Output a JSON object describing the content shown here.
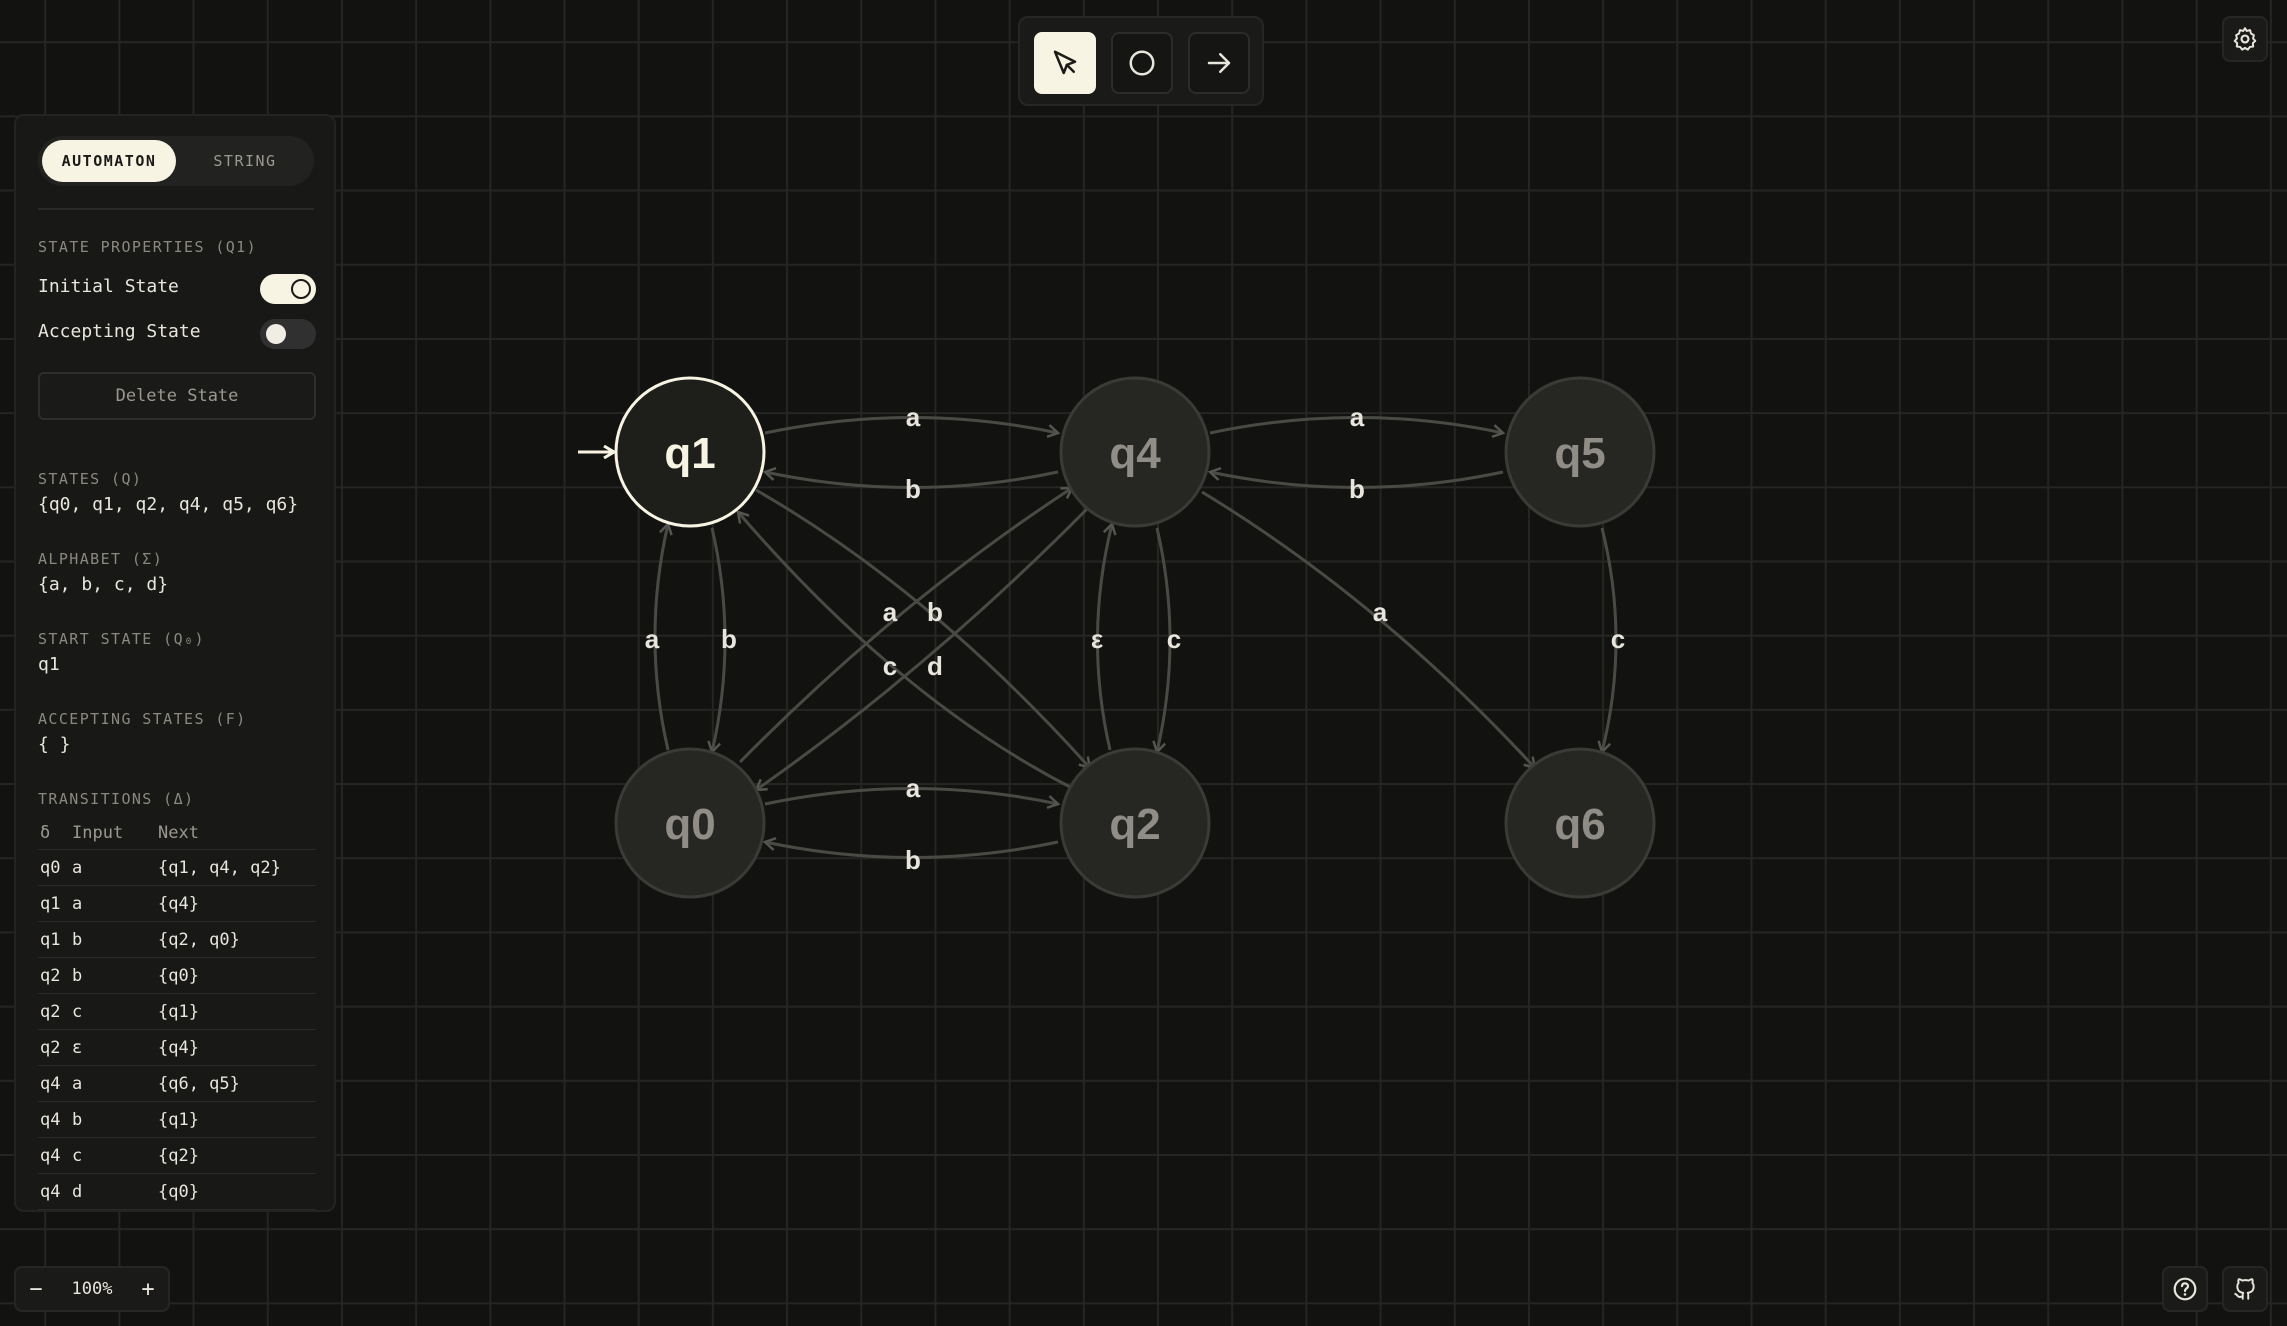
{
  "toolbar": {
    "tools": [
      {
        "name": "select",
        "icon": "cursor-icon",
        "active": true
      },
      {
        "name": "add-state",
        "icon": "circle-icon",
        "active": false
      },
      {
        "name": "add-transition",
        "icon": "arrow-right-icon",
        "active": false
      }
    ]
  },
  "sidebar": {
    "tabs": [
      {
        "label": "AUTOMATON",
        "active": true
      },
      {
        "label": "STRING",
        "active": false
      }
    ],
    "state_properties": {
      "title": "STATE PROPERTIES (Q1)",
      "initial_label": "Initial State",
      "initial_on": true,
      "accepting_label": "Accepting State",
      "accepting_on": false,
      "delete_label": "Delete State"
    },
    "states_label": "STATES (Q)",
    "states_value": "{q0, q1, q2, q4, q5, q6}",
    "alphabet_label": "ALPHABET (Σ)",
    "alphabet_value": "{a, b, c, d}",
    "start_label": "START STATE (Q₀)",
    "start_value": "q1",
    "accepting_states_label": "ACCEPTING STATES (F)",
    "accepting_states_value": "{ }",
    "transitions_label": "TRANSITIONS (Δ)",
    "transitions_header": {
      "from": "δ",
      "input": "Input",
      "next": "Next"
    },
    "transitions": [
      {
        "from": "q0",
        "input": "a",
        "next": "{q1, q4, q2}"
      },
      {
        "from": "q1",
        "input": "a",
        "next": "{q4}"
      },
      {
        "from": "q1",
        "input": "b",
        "next": "{q2, q0}"
      },
      {
        "from": "q2",
        "input": "b",
        "next": "{q0}"
      },
      {
        "from": "q2",
        "input": "c",
        "next": "{q1}"
      },
      {
        "from": "q2",
        "input": "ε",
        "next": "{q4}"
      },
      {
        "from": "q4",
        "input": "a",
        "next": "{q6, q5}"
      },
      {
        "from": "q4",
        "input": "b",
        "next": "{q1}"
      },
      {
        "from": "q4",
        "input": "c",
        "next": "{q2}"
      },
      {
        "from": "q4",
        "input": "d",
        "next": "{q0}"
      }
    ]
  },
  "zoom": {
    "minus": "−",
    "value": "100%",
    "plus": "+"
  },
  "corner_buttons": {
    "settings": "gear-icon",
    "help": "help-icon",
    "github": "github-icon"
  },
  "canvas": {
    "states": [
      {
        "id": "q1",
        "label": "q1",
        "selected": true,
        "initial": true
      },
      {
        "id": "q4",
        "label": "q4",
        "selected": false,
        "initial": false
      },
      {
        "id": "q5",
        "label": "q5",
        "selected": false,
        "initial": false
      },
      {
        "id": "q0",
        "label": "q0",
        "selected": false,
        "initial": false
      },
      {
        "id": "q2",
        "label": "q2",
        "selected": false,
        "initial": false
      },
      {
        "id": "q6",
        "label": "q6",
        "selected": false,
        "initial": false
      }
    ],
    "edge_labels": [
      "a",
      "b",
      "a",
      "b",
      "a",
      "b",
      "a",
      "b",
      "c",
      "d",
      "ε",
      "c",
      "a",
      "c",
      "a",
      "b"
    ]
  }
}
